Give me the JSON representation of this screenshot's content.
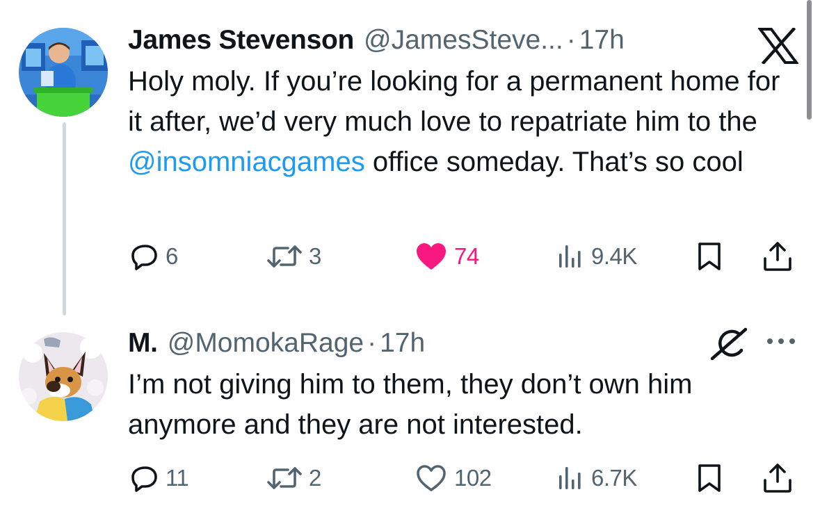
{
  "thread": {
    "tweets": [
      {
        "author": {
          "name": "James Stevenson",
          "handle": "@JamesSteve...",
          "avatar_icon": "avatar-photo"
        },
        "separator": "·",
        "time": "17h",
        "text_before": "Holy moly. If you’re looking for a permanent home for it after, we’d very much love to repatriate him to the ",
        "mention": "@insomniacgames",
        "text_after": " office someday. That’s so cool",
        "top_right_icon": "x-logo-icon",
        "actions": {
          "replies": "6",
          "reposts": "3",
          "likes": "74",
          "liked": true,
          "views": "9.4K"
        }
      },
      {
        "author": {
          "name": "M.",
          "handle": "@MomokaRage",
          "avatar_icon": "avatar-photo"
        },
        "separator": "·",
        "time": "17h",
        "text": "I’m not giving him to them, they don’t own him anymore and they are not interested.",
        "top_right_icons": [
          "grok-icon",
          "more-icon"
        ],
        "actions": {
          "replies": "11",
          "reposts": "2",
          "likes": "102",
          "liked": false,
          "views": "6.7K"
        }
      }
    ]
  },
  "colors": {
    "text": "#0f1419",
    "secondary": "#536471",
    "link": "#1d9bf0",
    "like": "#f91880",
    "thread_line": "#cfd9de"
  }
}
